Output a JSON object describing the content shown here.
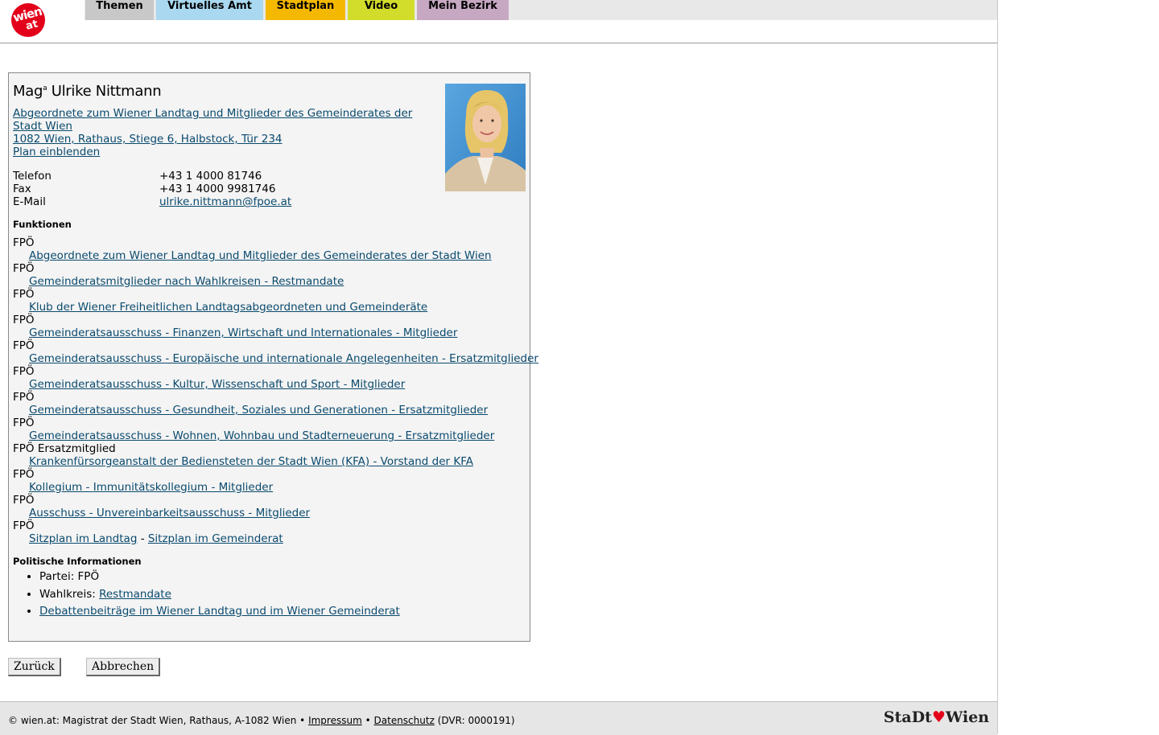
{
  "header": {
    "logo_top": "wien",
    "logo_bottom": "at",
    "nav": [
      {
        "label": "Themen",
        "color": "#c8c8c8"
      },
      {
        "label": "Virtuelles Amt",
        "color": "#a9d8f0"
      },
      {
        "label": "Stadtplan",
        "color": "#f5b800"
      },
      {
        "label": "Video",
        "color": "#d2dc2a"
      },
      {
        "label": "Mein Bezirk",
        "color": "#c7a8c2"
      }
    ]
  },
  "person": {
    "title": "Mag",
    "title_sup": "a",
    "name": "Ulrike Nittmann",
    "role_line1": "Abgeordnete zum Wiener Landtag und Mitglieder des Gemeinderates der",
    "role_line2": "Stadt Wien",
    "address": "1082 Wien, Rathaus, Stiege 6, Halbstock, Tür 234",
    "plan_link": "Plan einblenden",
    "contacts": [
      {
        "label": "Telefon",
        "value": "+43 1 4000 81746"
      },
      {
        "label": "Fax",
        "value": "+43 1 4000 9981746"
      },
      {
        "label": "E-Mail",
        "value": "ulrike.nittmann@fpoe.at"
      }
    ]
  },
  "functions": {
    "heading": "Funktionen",
    "items": [
      {
        "party": "FPÖ",
        "link": "Abgeordnete zum Wiener Landtag und Mitglieder des Gemeinderates der Stadt Wien"
      },
      {
        "party": "FPÖ",
        "link": "Gemeinderatsmitglieder nach Wahlkreisen - Restmandate"
      },
      {
        "party": "FPÖ",
        "link": "Klub der Wiener Freiheitlichen Landtagsabgeordneten und Gemeinderäte"
      },
      {
        "party": "FPÖ",
        "link": "Gemeinderatsausschuss - Finanzen, Wirtschaft und Internationales - Mitglieder"
      },
      {
        "party": "FPÖ",
        "link": "Gemeinderatsausschuss - Europäische und internationale Angelegenheiten - Ersatzmitglieder"
      },
      {
        "party": "FPÖ",
        "link": "Gemeinderatsausschuss - Kultur, Wissenschaft und Sport - Mitglieder"
      },
      {
        "party": "FPÖ",
        "link": "Gemeinderatsausschuss - Gesundheit, Soziales und Generationen - Ersatzmitglieder"
      },
      {
        "party": "FPÖ",
        "link": "Gemeinderatsausschuss - Wohnen, Wohnbau und Stadterneuerung - Ersatzmitglieder"
      },
      {
        "party": "FPÖ Ersatzmitglied",
        "link": "Krankenfürsorgeanstalt der Bediensteten der Stadt Wien (KFA) - Vorstand der KFA"
      },
      {
        "party": "FPÖ",
        "link": "Kollegium - Immunitätskollegium - Mitglieder"
      },
      {
        "party": "FPÖ",
        "link": "Ausschuss - Unvereinbarkeitsausschuss - Mitglieder"
      }
    ],
    "last_party": "FPÖ",
    "sitzplan_landtag": "Sitzplan im Landtag",
    "separator": "-",
    "sitzplan_gemeinderat": "Sitzplan im Gemeinderat"
  },
  "political": {
    "heading": "Politische Informationen",
    "partei_label": "Partei: FPÖ",
    "wahlkreis_label": "Wahlkreis: ",
    "wahlkreis_link": "Restmandate",
    "debatten_link": "Debattenbeiträge im Wiener Landtag und im Wiener Gemeinderat"
  },
  "buttons": {
    "back": "Zurück",
    "cancel": "Abbrechen"
  },
  "footer": {
    "text": "© wien.at: Magistrat der Stadt Wien, Rathaus, A-1082 Wien •",
    "impressum": "Impressum",
    "bullet": "•",
    "datenschutz": "Datenschutz",
    "dvr": "(DVR: 0000191)",
    "brand_left": "StaDt",
    "brand_mark": "♥",
    "brand_right": "Wien"
  }
}
